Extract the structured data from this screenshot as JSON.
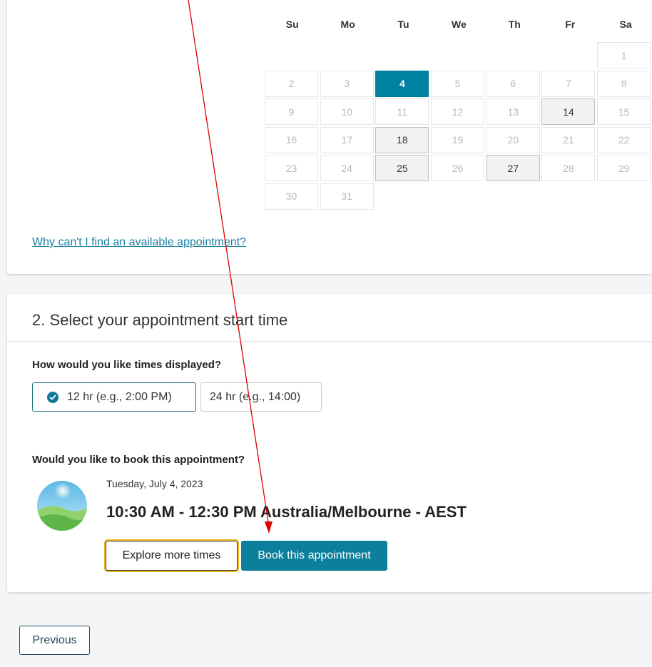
{
  "calendar": {
    "weekdays": [
      "Su",
      "Mo",
      "Tu",
      "We",
      "Th",
      "Fr",
      "Sa"
    ],
    "leading_blanks": 6,
    "days": [
      {
        "n": "1",
        "state": "disabled"
      },
      {
        "n": "2",
        "state": "disabled"
      },
      {
        "n": "3",
        "state": "disabled"
      },
      {
        "n": "4",
        "state": "selected"
      },
      {
        "n": "5",
        "state": "disabled"
      },
      {
        "n": "6",
        "state": "disabled"
      },
      {
        "n": "7",
        "state": "disabled"
      },
      {
        "n": "8",
        "state": "disabled"
      },
      {
        "n": "9",
        "state": "disabled"
      },
      {
        "n": "10",
        "state": "disabled"
      },
      {
        "n": "11",
        "state": "disabled"
      },
      {
        "n": "12",
        "state": "disabled"
      },
      {
        "n": "13",
        "state": "disabled"
      },
      {
        "n": "14",
        "state": "available"
      },
      {
        "n": "15",
        "state": "disabled"
      },
      {
        "n": "16",
        "state": "disabled"
      },
      {
        "n": "17",
        "state": "disabled"
      },
      {
        "n": "18",
        "state": "available"
      },
      {
        "n": "19",
        "state": "disabled"
      },
      {
        "n": "20",
        "state": "disabled"
      },
      {
        "n": "21",
        "state": "disabled"
      },
      {
        "n": "22",
        "state": "disabled"
      },
      {
        "n": "23",
        "state": "disabled"
      },
      {
        "n": "24",
        "state": "disabled"
      },
      {
        "n": "25",
        "state": "available"
      },
      {
        "n": "26",
        "state": "disabled"
      },
      {
        "n": "27",
        "state": "available"
      },
      {
        "n": "28",
        "state": "disabled"
      },
      {
        "n": "29",
        "state": "disabled"
      },
      {
        "n": "30",
        "state": "disabled"
      },
      {
        "n": "31",
        "state": "disabled"
      }
    ],
    "help_link": "Why can't I find an available appointment?"
  },
  "time_section": {
    "title": "2. Select your appointment start time",
    "format_question": "How would you like times displayed?",
    "format_12": "12 hr (e.g., 2:00 PM)",
    "format_24": "24 hr (e.g., 14:00)",
    "selected_format": "12",
    "book_question": "Would you like to book this appointment?",
    "appointment_date": "Tuesday, July 4, 2023",
    "appointment_time": "10:30 AM - 12:30 PM Australia/Melbourne - AEST",
    "explore_label": "Explore more times",
    "book_label": "Book this appointment"
  },
  "navigation": {
    "previous_label": "Previous"
  },
  "colors": {
    "accent": "#0081a1",
    "focus_ring": "#f1b81c",
    "link": "#1a7fa0",
    "annotation_arrow": "#e00000"
  },
  "icons": {
    "format_selected": "check-circle-icon",
    "appointment_avatar": "landscape-sun-icon"
  }
}
